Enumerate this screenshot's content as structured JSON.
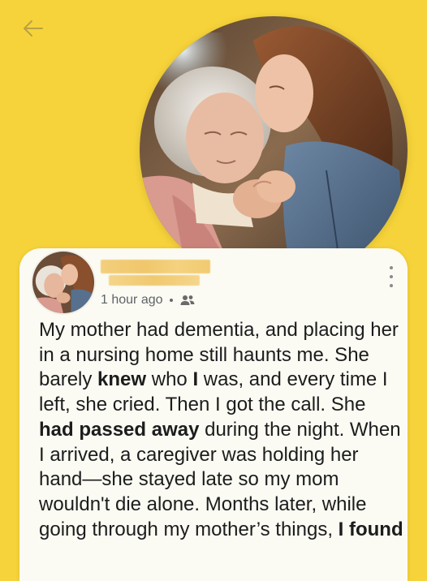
{
  "colors": {
    "background": "#f6d33a",
    "card": "#fbfbf4",
    "text": "#1c1c1c",
    "meta_text": "#5f6368"
  },
  "header": {
    "back_icon": "arrow-left-icon"
  },
  "hero_image": {
    "subject": "photo of a younger woman kissing the forehead of an elderly woman"
  },
  "post": {
    "author_name": "",
    "time_ago": "1 hour ago",
    "audience_icon": "friends-icon",
    "more_icon": "more-vertical-icon",
    "body_segments": [
      {
        "text": "My mother had dementia, and placing her in a nursing home still haunts me. She barely ",
        "bold": false
      },
      {
        "text": "knew",
        "bold": true
      },
      {
        "text": " who ",
        "bold": false
      },
      {
        "text": "I",
        "bold": true
      },
      {
        "text": " was, and every time I left, she cried. Then I got the call. She ",
        "bold": false
      },
      {
        "text": "had passed away",
        "bold": true
      },
      {
        "text": " during the night. When I arrived, a caregiver was holding her hand—she stayed late so my mom wouldn't die alone. Months later, while going through my mother’s things, ",
        "bold": false
      },
      {
        "text": "I found",
        "bold": true
      }
    ]
  }
}
